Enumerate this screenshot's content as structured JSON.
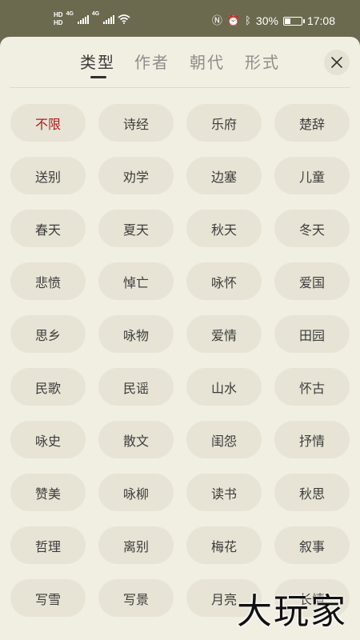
{
  "status_bar": {
    "hd_labels": [
      "HD",
      "HD"
    ],
    "network_labels": [
      "4G",
      "4G"
    ],
    "battery_text": "30%",
    "battery_level": 0.3,
    "time": "17:08",
    "icons": [
      "nfc-icon",
      "alarm-icon",
      "bluetooth-icon",
      "battery-icon",
      "wifi-icon"
    ]
  },
  "tabs": [
    {
      "label": "类型",
      "active": true
    },
    {
      "label": "作者",
      "active": false
    },
    {
      "label": "朝代",
      "active": false
    },
    {
      "label": "形式",
      "active": false
    }
  ],
  "categories": [
    "不限",
    "诗经",
    "乐府",
    "楚辞",
    "送别",
    "劝学",
    "边塞",
    "儿童",
    "春天",
    "夏天",
    "秋天",
    "冬天",
    "悲愤",
    "悼亡",
    "咏怀",
    "爱国",
    "思乡",
    "咏物",
    "爱情",
    "田园",
    "民歌",
    "民谣",
    "山水",
    "怀古",
    "咏史",
    "散文",
    "闺怨",
    "抒情",
    "赞美",
    "咏柳",
    "读书",
    "秋思",
    "哲理",
    "离别",
    "梅花",
    "叙事",
    "写雪",
    "写景",
    "月亮",
    "长情"
  ],
  "selected_category": "不限",
  "watermark": "大玩家",
  "colors": {
    "status_bar_bg": "#6b6a4e",
    "sheet_bg": "#f1efe2",
    "chip_bg": "#e7e4d5",
    "selected_text": "#b01c1c"
  }
}
